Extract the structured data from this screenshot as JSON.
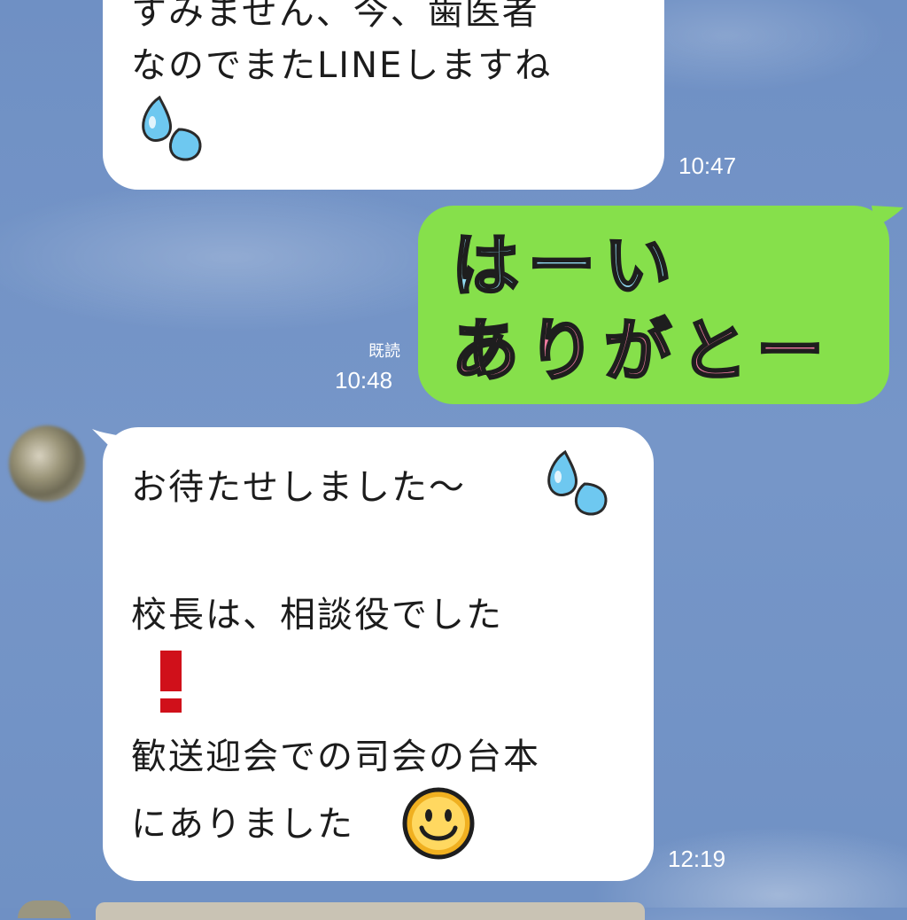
{
  "chat": {
    "msg1": {
      "line1": "すみません、今、歯医者",
      "line2": "なのでまたLINEしますね",
      "time": "10:47"
    },
    "msg2": {
      "sticker_line1": "はーい",
      "sticker_line2": "ありがとー",
      "read_label": "既読",
      "time": "10:48"
    },
    "msg3": {
      "line1": "お待たせしました〜",
      "line2": "校長は、相談役でした",
      "line3": "歓送迎会での司会の台本",
      "line4": "にありました",
      "time": "12:19"
    }
  },
  "icons": {
    "sweat": "sweat-drops-icon",
    "exclamation": "red-exclamation-icon",
    "smile": "smiley-face-icon"
  },
  "colors": {
    "background": "#7193c6",
    "incoming_bubble": "#ffffff",
    "outgoing_bubble": "#86e04b",
    "exclamation": "#d0101a",
    "smiley": "#f0b020"
  }
}
